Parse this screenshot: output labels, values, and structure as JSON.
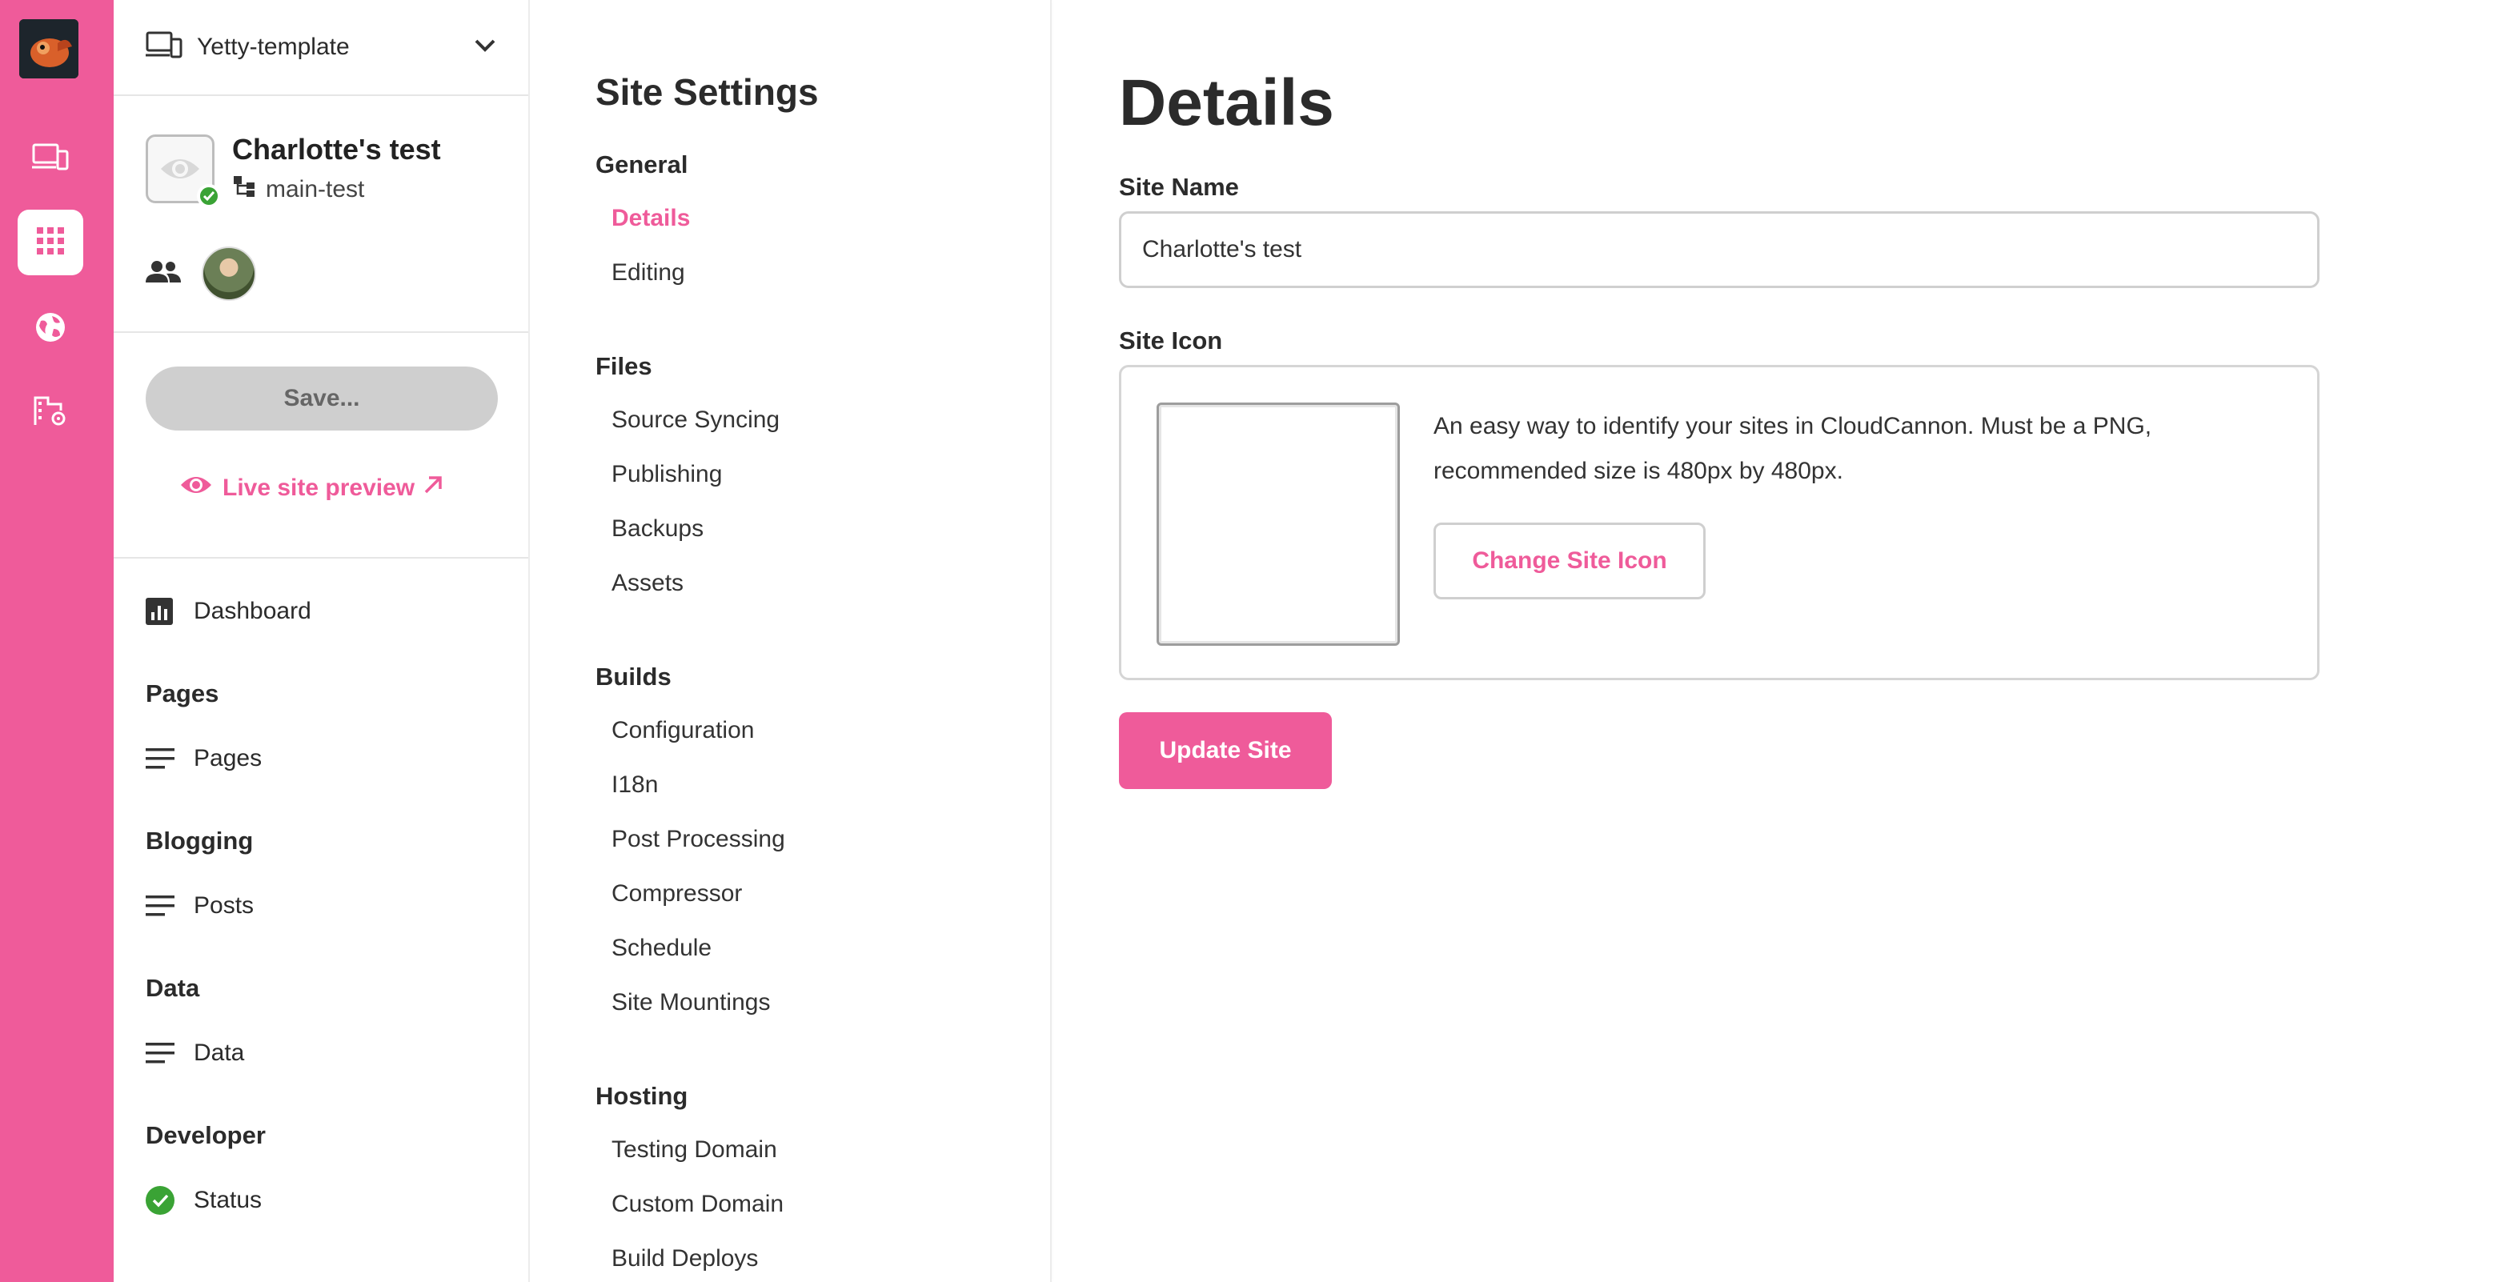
{
  "colors": {
    "accent": "#ef5b9a",
    "success": "#3aa335"
  },
  "rail": {
    "items": [
      {
        "icon": "devices-icon",
        "active": false
      },
      {
        "icon": "apps-grid-icon",
        "active": true
      },
      {
        "icon": "globe-icon",
        "active": false
      },
      {
        "icon": "org-settings-icon",
        "active": false
      }
    ]
  },
  "site_switcher": {
    "label": "Yetty-template"
  },
  "site": {
    "name": "Charlotte's test",
    "branch": "main-test"
  },
  "save_label": "Save...",
  "preview_label": "Live site preview",
  "sidebar_nav": {
    "dashboard": "Dashboard",
    "pages_heading": "Pages",
    "pages": "Pages",
    "blogging_heading": "Blogging",
    "posts": "Posts",
    "data_heading": "Data",
    "data": "Data",
    "developer_heading": "Developer",
    "status": "Status"
  },
  "settings": {
    "title": "Site Settings",
    "general": {
      "title": "General",
      "links": [
        "Details",
        "Editing"
      ]
    },
    "files": {
      "title": "Files",
      "links": [
        "Source Syncing",
        "Publishing",
        "Backups",
        "Assets"
      ]
    },
    "builds": {
      "title": "Builds",
      "links": [
        "Configuration",
        "I18n",
        "Post Processing",
        "Compressor",
        "Schedule",
        "Site Mountings"
      ]
    },
    "hosting": {
      "title": "Hosting",
      "links": [
        "Testing Domain",
        "Custom Domain",
        "Build Deploys"
      ]
    }
  },
  "details": {
    "title": "Details",
    "site_name_label": "Site Name",
    "site_name_value": "Charlotte's test",
    "site_icon_label": "Site Icon",
    "site_icon_help_1": "An easy way to identify your sites in CloudCannon. Must be a PNG,",
    "site_icon_help_2": "recommended size is 480px by 480px.",
    "change_icon_label": "Change Site Icon",
    "update_label": "Update Site"
  }
}
